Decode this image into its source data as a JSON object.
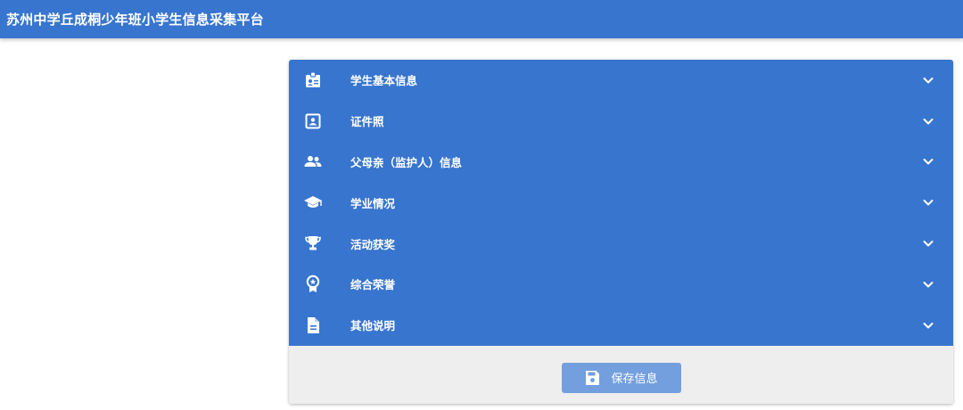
{
  "header": {
    "title": "苏州中学丘成桐少年班小学生信息采集平台"
  },
  "sections": [
    {
      "label": "学生基本信息",
      "icon": "id-badge-icon"
    },
    {
      "label": "证件照",
      "icon": "portrait-icon"
    },
    {
      "label": "父母亲（监护人）信息",
      "icon": "people-icon"
    },
    {
      "label": "学业情况",
      "icon": "graduation-cap-icon"
    },
    {
      "label": "活动获奖",
      "icon": "trophy-icon"
    },
    {
      "label": "综合荣誉",
      "icon": "award-ribbon-icon"
    },
    {
      "label": "其他说明",
      "icon": "document-icon"
    }
  ],
  "footer": {
    "save_label": "保存信息",
    "save_icon": "floppy-disk-icon"
  },
  "colors": {
    "primary": "#3875cf",
    "button": "#739fdf",
    "footer_bg": "#eeeeee"
  }
}
